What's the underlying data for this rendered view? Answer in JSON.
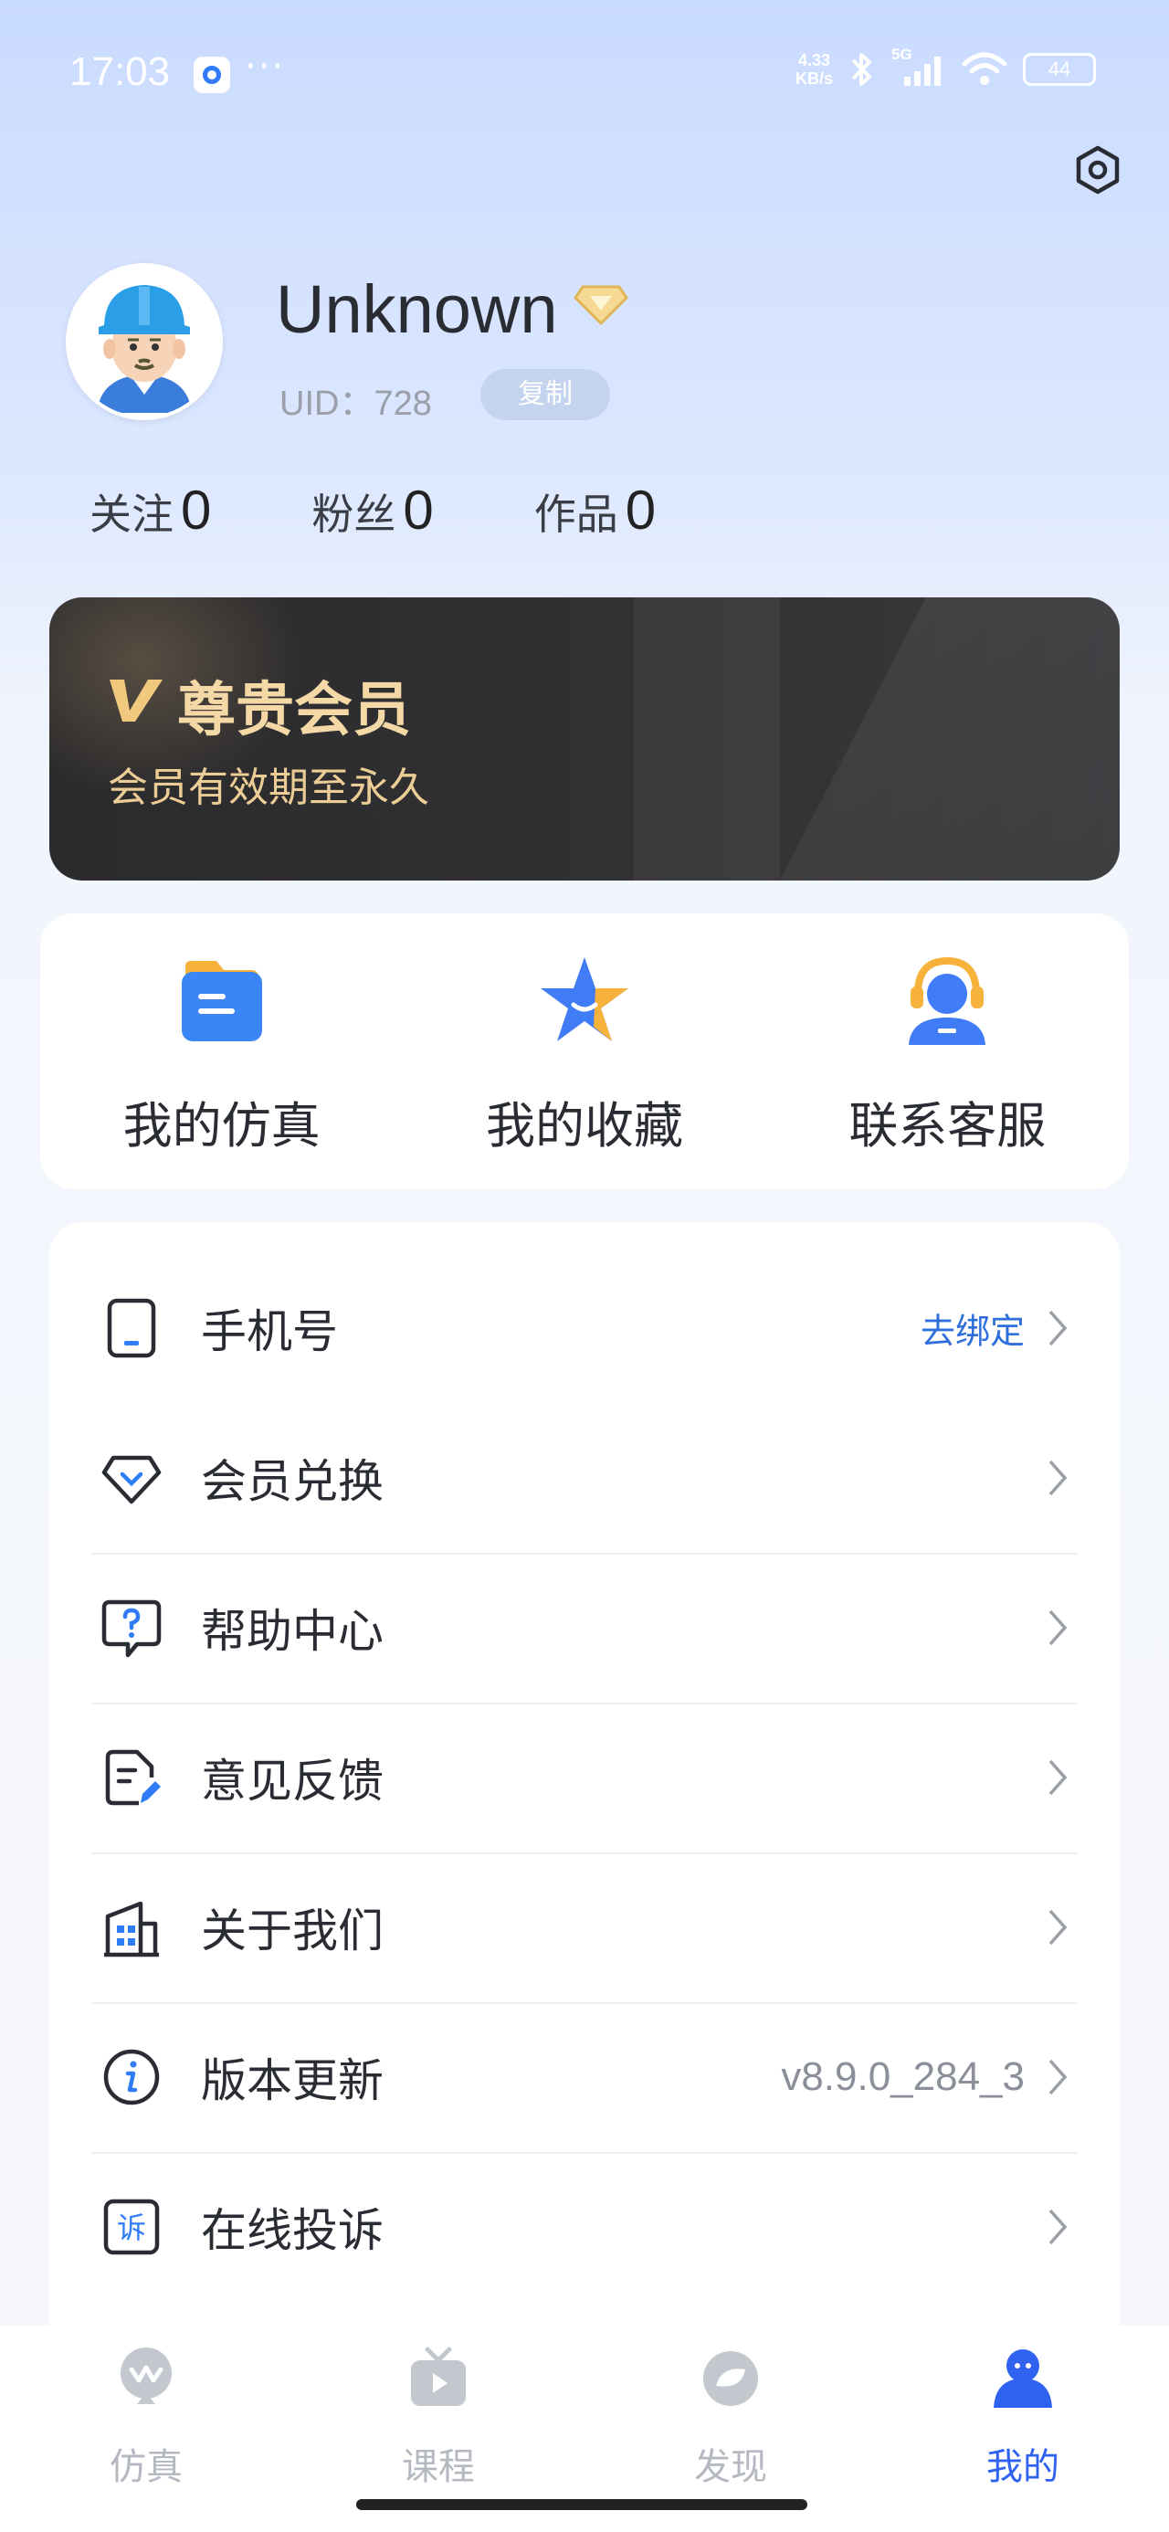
{
  "status_bar": {
    "time": "17:03",
    "more_dots": "···",
    "network_speed_value": "4.33",
    "network_speed_unit": "KB/s",
    "network_type": "5G",
    "battery": "44"
  },
  "profile": {
    "username": "Unknown",
    "uid": "UID：728",
    "copy_label": "复制"
  },
  "stats": [
    {
      "label": "关注",
      "value": "0"
    },
    {
      "label": "粉丝",
      "value": "0"
    },
    {
      "label": "作品",
      "value": "0"
    }
  ],
  "vip_card": {
    "title": "尊贵会员",
    "subtitle": "会员有效期至永久"
  },
  "quick_actions": [
    {
      "label": "我的仿真",
      "icon": "folder-icon"
    },
    {
      "label": "我的收藏",
      "icon": "star-icon"
    },
    {
      "label": "联系客服",
      "icon": "customer-service-icon"
    }
  ],
  "menu": [
    {
      "label": "手机号",
      "value": "去绑定",
      "icon": "phone-icon"
    },
    {
      "label": "会员兑换",
      "value": "",
      "icon": "diamond-icon"
    },
    {
      "label": "帮助中心",
      "value": "",
      "icon": "help-icon"
    },
    {
      "label": "意见反馈",
      "value": "",
      "icon": "feedback-icon"
    },
    {
      "label": "关于我们",
      "value": "",
      "icon": "building-icon"
    },
    {
      "label": "版本更新",
      "value": "v8.9.0_284_3",
      "icon": "info-icon"
    },
    {
      "label": "在线投诉",
      "value": "",
      "icon": "complaint-icon"
    }
  ],
  "tab_bar": [
    {
      "label": "仿真",
      "icon": "simulation-icon",
      "active": false
    },
    {
      "label": "课程",
      "icon": "tv-icon",
      "active": false
    },
    {
      "label": "发现",
      "icon": "discover-icon",
      "active": false
    },
    {
      "label": "我的",
      "icon": "profile-icon",
      "active": true
    }
  ],
  "colors": {
    "accent": "#2f62f0",
    "vip_gold": "#f4d9a6",
    "link": "#2f6fdc"
  }
}
